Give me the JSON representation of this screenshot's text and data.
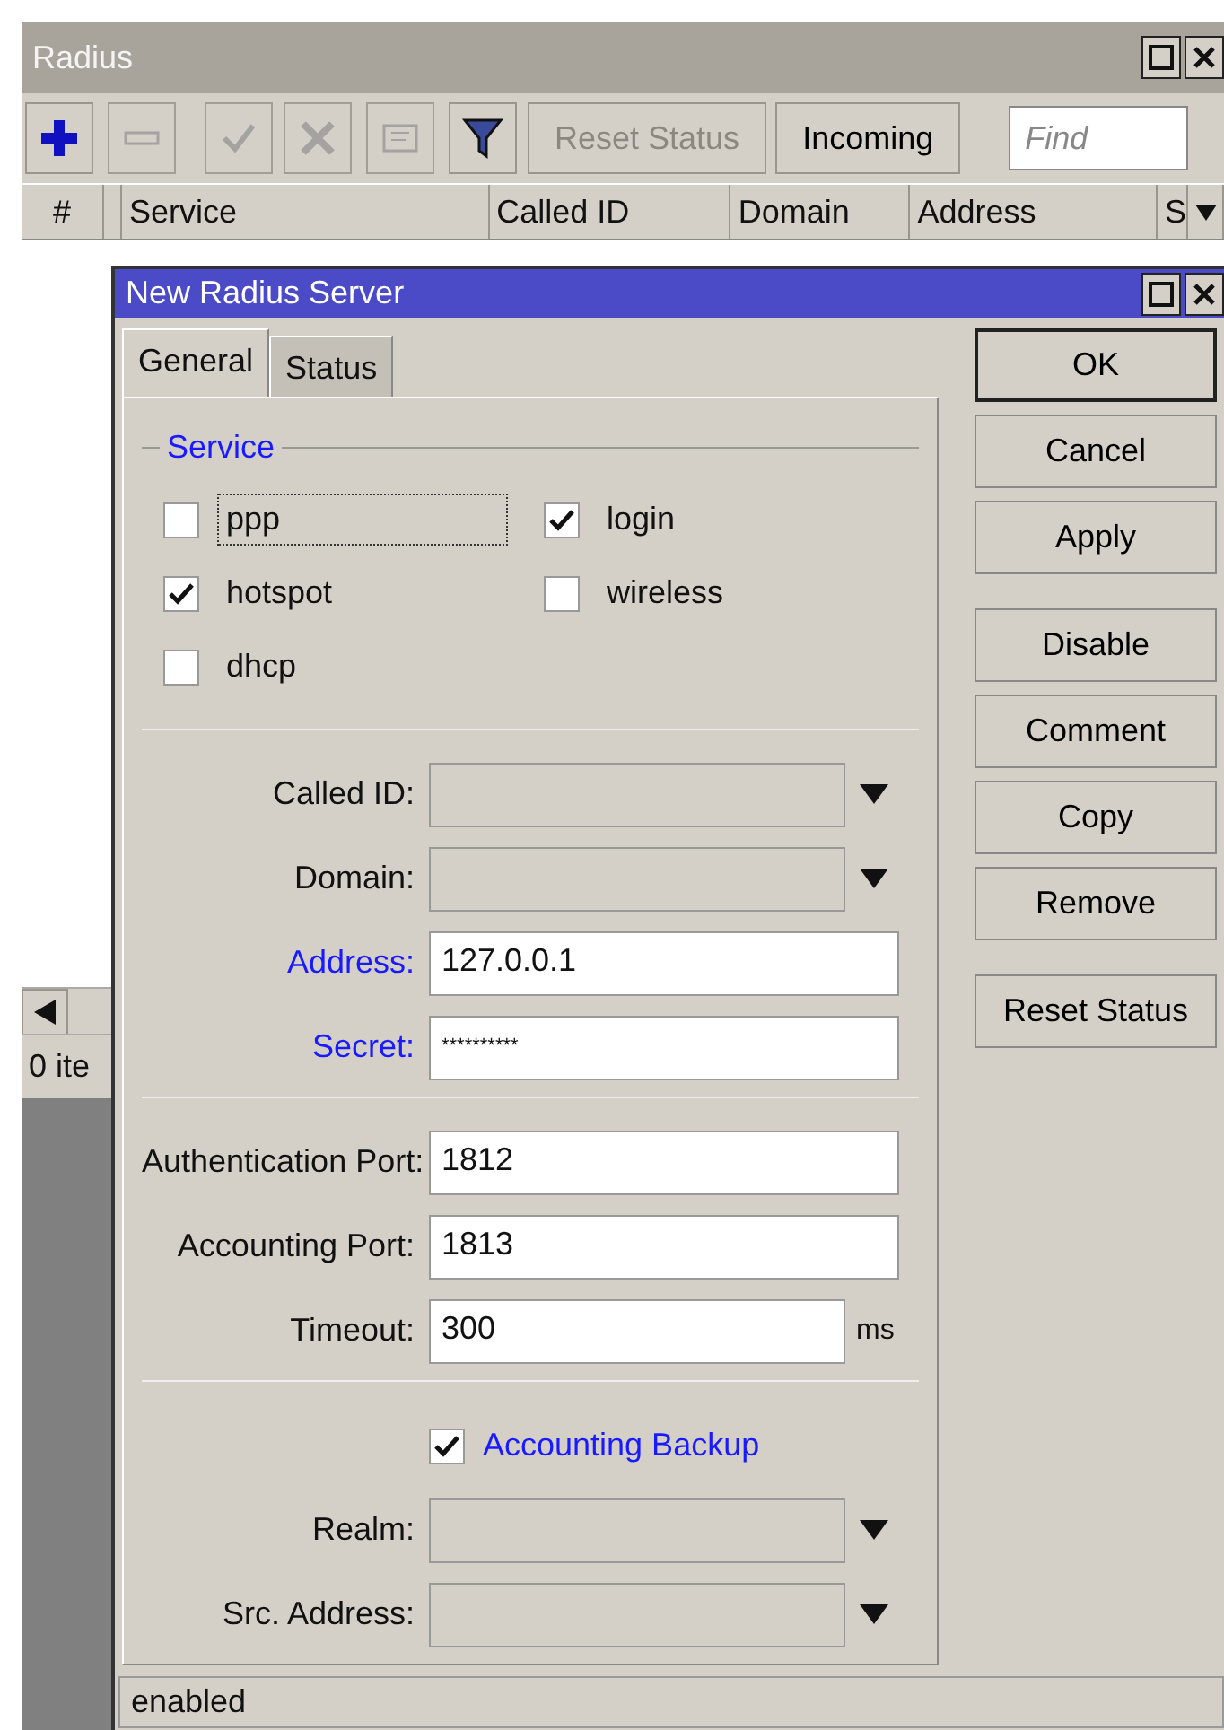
{
  "radius_window": {
    "title": "Radius",
    "toolbar": {
      "icon_buttons": [
        {
          "kind": "add",
          "disabled": false
        },
        {
          "kind": "remove",
          "disabled": true
        },
        {
          "kind": "enable",
          "disabled": true
        },
        {
          "kind": "disable",
          "disabled": true
        },
        {
          "kind": "comment",
          "disabled": true
        },
        {
          "kind": "filter",
          "disabled": false
        }
      ],
      "text_buttons": [
        {
          "label": "Reset Status",
          "disabled": true
        },
        {
          "label": "Incoming",
          "disabled": false
        }
      ],
      "find": {
        "placeholder": "Find"
      }
    },
    "columns": [
      "#",
      "",
      "Service",
      "Called ID",
      "Domain",
      "Address",
      "S"
    ],
    "status_bar": "0 ite"
  },
  "dialog": {
    "title": "New Radius Server",
    "tabs": [
      {
        "label": "General",
        "selected": true
      },
      {
        "label": "Status",
        "selected": false
      }
    ],
    "service": {
      "title": "Service",
      "options": [
        {
          "label": "ppp",
          "checked": false,
          "focused": true
        },
        {
          "label": "login",
          "checked": true,
          "focused": false
        },
        {
          "label": "hotspot",
          "checked": true,
          "focused": false
        },
        {
          "label": "wireless",
          "checked": false,
          "focused": false
        },
        {
          "label": "dhcp",
          "checked": false,
          "focused": false
        }
      ]
    },
    "sections": [
      [
        {
          "kind": "combo",
          "label": "Called ID:",
          "highlighted": false
        },
        {
          "kind": "combo",
          "label": "Domain:",
          "highlighted": false
        },
        {
          "kind": "text",
          "label": "Address:",
          "value": "127.0.0.1",
          "highlighted": true
        },
        {
          "kind": "secret",
          "label": "Secret:",
          "value": "**********",
          "highlighted": true
        }
      ],
      [
        {
          "kind": "text",
          "label": "Authentication Port:",
          "value": "1812",
          "highlighted": false
        },
        {
          "kind": "text",
          "label": "Accounting Port:",
          "value": "1813",
          "highlighted": false
        },
        {
          "kind": "text",
          "label": "Timeout:",
          "value": "300",
          "unit": "ms",
          "highlighted": false
        }
      ],
      [
        {
          "kind": "checkbox",
          "label": "Accounting Backup",
          "checked": true,
          "highlighted": true
        },
        {
          "kind": "combo",
          "label": "Realm:",
          "highlighted": false
        },
        {
          "kind": "combo",
          "label": "Src. Address:",
          "highlighted": false
        }
      ]
    ],
    "button_groups": [
      [
        {
          "label": "OK",
          "default": true
        },
        {
          "label": "Cancel",
          "default": false
        },
        {
          "label": "Apply",
          "default": false
        }
      ],
      [
        {
          "label": "Disable",
          "default": false
        },
        {
          "label": "Comment",
          "default": false
        },
        {
          "label": "Copy",
          "default": false
        },
        {
          "label": "Remove",
          "default": false
        }
      ],
      [
        {
          "label": "Reset Status",
          "default": false
        }
      ]
    ],
    "status_bar": "enabled"
  }
}
